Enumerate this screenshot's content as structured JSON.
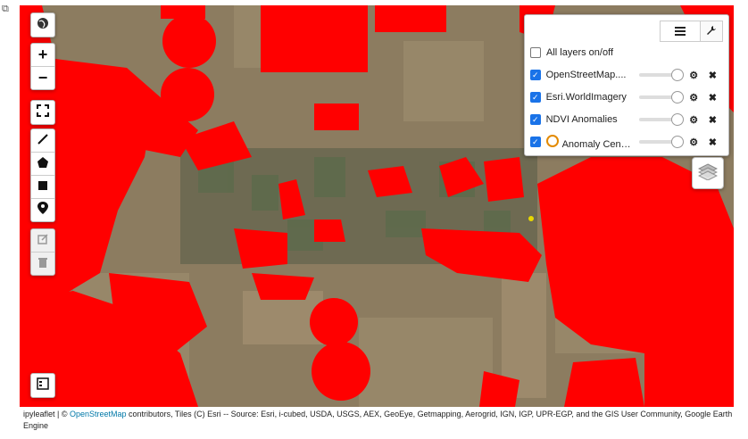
{
  "map": {
    "controls": {
      "globe_icon": "globe-icon",
      "zoom_in": "+",
      "zoom_out": "−",
      "fullscreen_icon": "fullscreen-icon",
      "draw_tools": [
        "line-icon",
        "pentagon-icon",
        "square-icon",
        "marker-icon"
      ],
      "edit_tools": [
        "edit-icon",
        "trash-icon"
      ],
      "legend_icon": "legend-icon"
    },
    "overlay_color": "#ff0000"
  },
  "layers_panel": {
    "tab_list_icon": "list-icon",
    "tab_wrench_icon": "wrench-icon",
    "all_layers_label": "All layers on/off",
    "layers": [
      {
        "name": "OpenStreetMap....",
        "checked": true,
        "opacity": 1
      },
      {
        "name": "Esri.WorldImagery",
        "checked": true,
        "opacity": 1
      },
      {
        "name": "NDVI Anomalies",
        "checked": true,
        "opacity": 1
      },
      {
        "name": "Anomaly Center",
        "checked": true,
        "opacity": 1,
        "icon": "clock-icon"
      }
    ],
    "gear_symbol": "⚙",
    "close_symbol": "✖"
  },
  "attribution": {
    "prefix": "ipyleaflet | © ",
    "link": "OpenStreetMap",
    "suffix": " contributors, Tiles (C) Esri -- Source: Esri, i-cubed, USDA, USGS, AEX, GeoEye, Getmapping, Aerogrid, IGN, IGP, UPR-EGP, and the GIS User Community, Google Earth Engine"
  }
}
